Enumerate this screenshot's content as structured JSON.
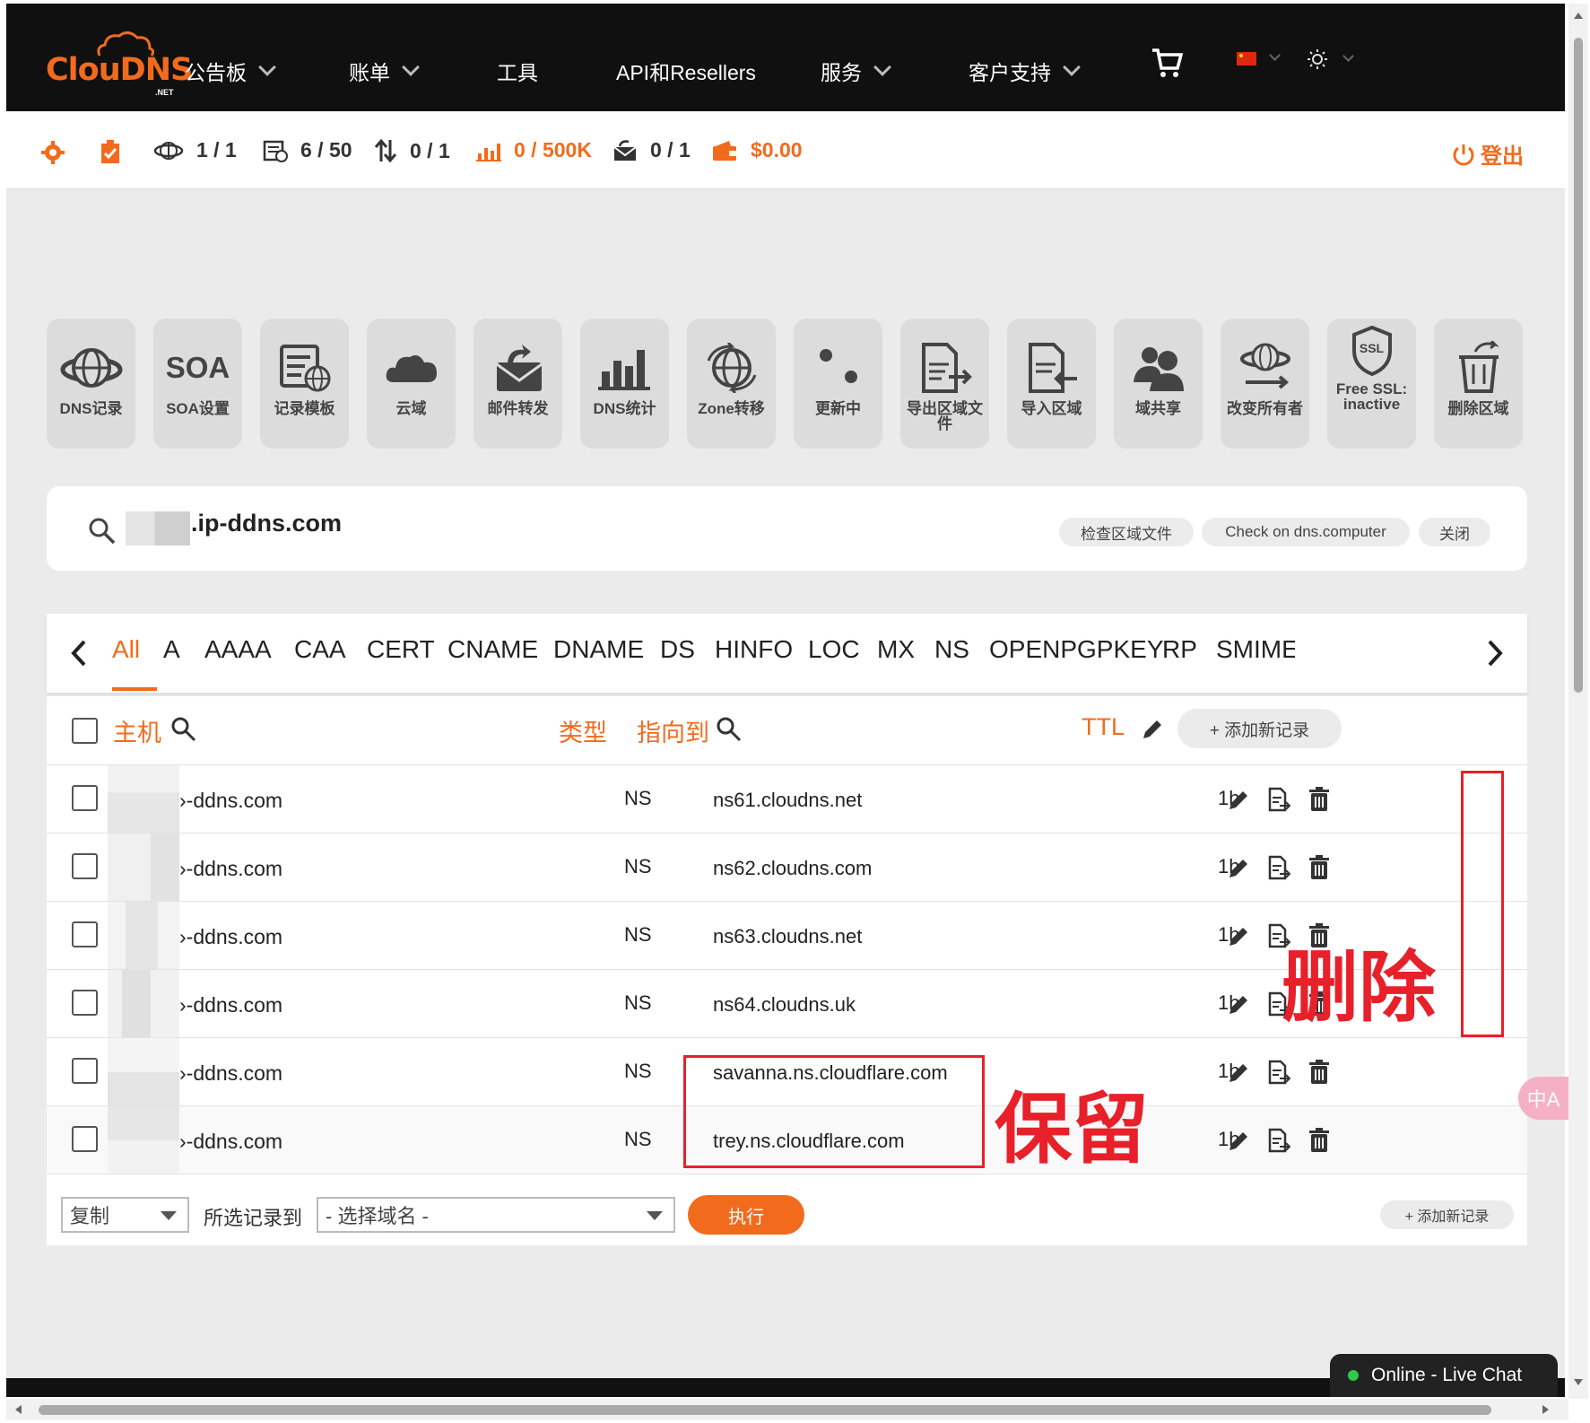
{
  "brand": {
    "logo_text": "ClouDNS",
    "logo_sub": ".NET",
    "accent": "#f26b1d"
  },
  "nav": {
    "items": [
      "公告板",
      "账单",
      "工具",
      "API和Resellers",
      "服务",
      "客户支持"
    ],
    "cart_icon": "cart-icon",
    "language_icon": "china-flag-icon",
    "theme_icon": "sun-icon"
  },
  "stats": {
    "zones": "1 / 1",
    "records": "6 / 50",
    "transfers": "0 / 1",
    "queries": "0 / 500K",
    "mail": "0 / 1",
    "balance": "$0.00",
    "logout": "登出"
  },
  "tools": [
    {
      "label": "DNS记录",
      "icon": "globe-icon"
    },
    {
      "label": "SOA设置",
      "icon": "soa-text-icon",
      "text": "SOA"
    },
    {
      "label": "记录模板",
      "icon": "template-icon"
    },
    {
      "label": "云域",
      "icon": "cloud-icon"
    },
    {
      "label": "邮件转发",
      "icon": "mail-forward-icon"
    },
    {
      "label": "DNS统计",
      "icon": "bar-chart-icon"
    },
    {
      "label": "Zone转移",
      "icon": "zone-transfer-icon"
    },
    {
      "label": "更新中",
      "icon": "updating-icon"
    },
    {
      "label": "导出区域文件",
      "icon": "export-icon"
    },
    {
      "label": "导入区域",
      "icon": "import-icon"
    },
    {
      "label": "域共享",
      "icon": "users-icon"
    },
    {
      "label": "改变所有者",
      "icon": "change-owner-icon"
    },
    {
      "label": "Free SSL: inactive",
      "icon": "ssl-shield-icon",
      "text": "SSL"
    },
    {
      "label": "删除区域",
      "icon": "trash-zone-icon"
    }
  ],
  "domain": {
    "name": ".ip-ddns.com",
    "buttons": [
      "检查区域文件",
      "Check on dns.computer",
      "关闭"
    ]
  },
  "record_types": [
    "All",
    "A",
    "AAAA",
    "CAA",
    "CERT",
    "CNAME",
    "DNAME",
    "DS",
    "HINFO",
    "LOC",
    "MX",
    "NS",
    "OPENPGPKEY",
    "RP",
    "SMIMEA"
  ],
  "table": {
    "headers": {
      "host": "主机",
      "type": "类型",
      "points_to": "指向到",
      "ttl": "TTL"
    },
    "add_record": "+ 添加新记录",
    "rows": [
      {
        "host": "›-ddns.com",
        "type": "NS",
        "target": "ns61.cloudns.net",
        "ttl": "1h"
      },
      {
        "host": "›-ddns.com",
        "type": "NS",
        "target": "ns62.cloudns.com",
        "ttl": "1h"
      },
      {
        "host": "›-ddns.com",
        "type": "NS",
        "target": "ns63.cloudns.net",
        "ttl": "1h"
      },
      {
        "host": "›-ddns.com",
        "type": "NS",
        "target": "ns64.cloudns.uk",
        "ttl": "1h"
      },
      {
        "host": "›-ddns.com",
        "type": "NS",
        "target": "savanna.ns.cloudflare.com",
        "ttl": "1h"
      },
      {
        "host": "›-ddns.com",
        "type": "NS",
        "target": "trey.ns.cloudflare.com",
        "ttl": "1h"
      }
    ]
  },
  "bulk": {
    "action": "复制",
    "label": "所选记录到",
    "domain_select": "- 选择域名 -",
    "run": "执行",
    "add_record": "+ 添加新记录"
  },
  "annotations": {
    "delete": "删除",
    "keep": "保留",
    "color": "#e8202a"
  },
  "chat": {
    "label": "Online - Live Chat"
  },
  "translate": {
    "label": "中A"
  }
}
